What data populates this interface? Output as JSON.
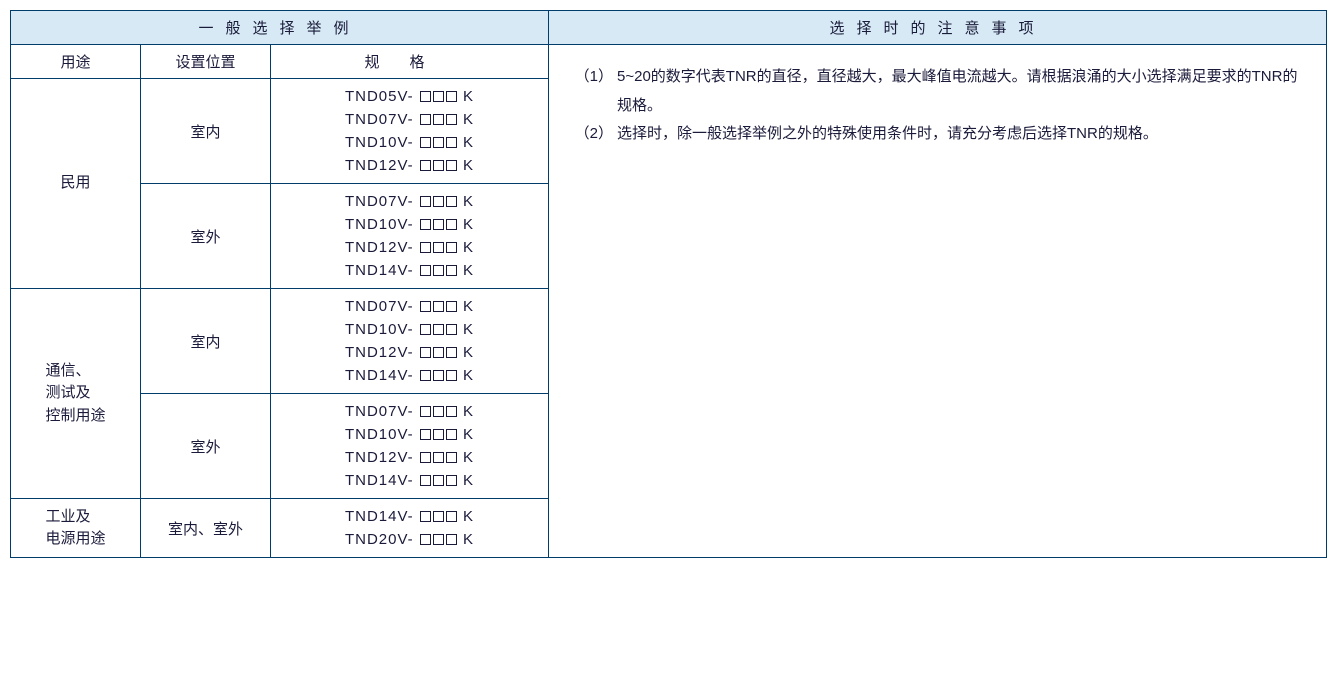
{
  "header": {
    "left_title": "一般选择举例",
    "right_title": "选择时的注意事项"
  },
  "subheader": {
    "use": "用途",
    "location": "设置位置",
    "spec": "规格"
  },
  "rows": [
    {
      "use": "民用",
      "groups": [
        {
          "location": "室内",
          "specs": [
            "TND05V-",
            "TND07V-",
            "TND10V-",
            "TND12V-"
          ]
        },
        {
          "location": "室外",
          "specs": [
            "TND07V-",
            "TND10V-",
            "TND12V-",
            "TND14V-"
          ]
        }
      ]
    },
    {
      "use": "通信、\n测试及\n控制用途",
      "groups": [
        {
          "location": "室内",
          "specs": [
            "TND07V-",
            "TND10V-",
            "TND12V-",
            "TND14V-"
          ]
        },
        {
          "location": "室外",
          "specs": [
            "TND07V-",
            "TND10V-",
            "TND12V-",
            "TND14V-"
          ]
        }
      ]
    },
    {
      "use": "工业及\n电源用途",
      "groups": [
        {
          "location": "室内、室外",
          "specs": [
            "TND14V-",
            "TND20V-"
          ]
        }
      ]
    }
  ],
  "spec_suffix": "K",
  "notes": [
    {
      "num": "（1）",
      "text": "5~20的数字代表TNR的直径，直径越大，最大峰值电流越大。请根据浪涌的大小选择满足要求的TNR的规格。"
    },
    {
      "num": "（2）",
      "text": "选择时，除一般选择举例之外的特殊使用条件时，请充分考虑后选择TNR的规格。"
    }
  ]
}
